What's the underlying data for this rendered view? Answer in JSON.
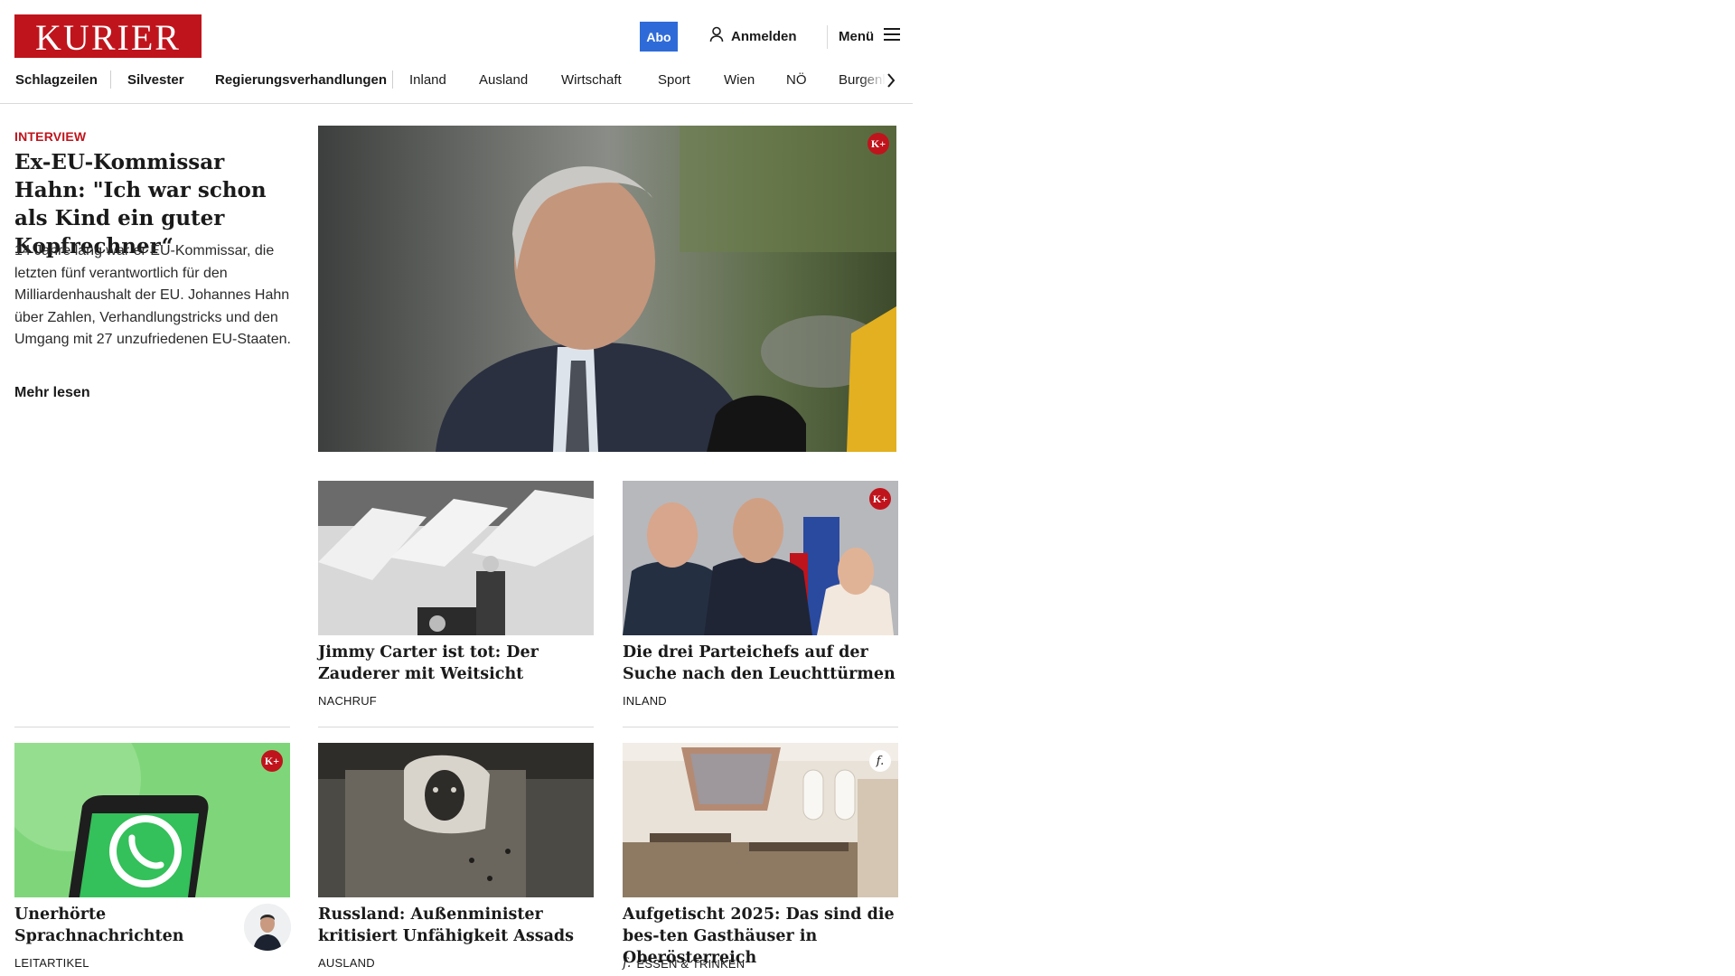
{
  "brand": {
    "name": "KURIER",
    "color": "#c0141c"
  },
  "header": {
    "abo_label": "Abo",
    "login_label": "Anmelden",
    "menu_label": "Menü"
  },
  "nav": {
    "items": [
      {
        "label": "Schlagzeilen"
      },
      {
        "label": "Silvester"
      },
      {
        "label": "Regierungsverhandlungen"
      },
      {
        "label": "Inland"
      },
      {
        "label": "Ausland"
      },
      {
        "label": "Wirtschaft"
      },
      {
        "label": "Sport"
      },
      {
        "label": "Wien"
      },
      {
        "label": "NÖ"
      },
      {
        "label": "Burgenl"
      }
    ]
  },
  "lead": {
    "kicker": "INTERVIEW",
    "title": "Ex-EU-Kommissar Hahn: \"Ich war schon als Kind ein guter Kopfrechner“",
    "teaser": "14 Jahre lang war er EU-Kommissar, die letzten fünf verantwortlich für den Milliardenhaushalt der EU. Johannes Hahn über Zahlen, Verhandlungstricks und den Umgang mit 27 unzufriedenen EU-Staaten.",
    "more": "Mehr lesen",
    "badge": "K+"
  },
  "cards": [
    {
      "title": "Jimmy Carter ist tot: Der Zauderer mit Weitsicht",
      "kicker": "NACHRUF"
    },
    {
      "title": "Die drei Parteichefs auf der Suche nach den Leuchttürmen",
      "kicker": "INLAND",
      "badge": "K+"
    },
    {
      "title": "Unerhörte Sprachnachrichten",
      "kicker": "LEITARTIKEL",
      "badge": "K+"
    },
    {
      "title": "Russland: Außenminister kritisiert Unfähigkeit Assads",
      "kicker": "AUSLAND"
    },
    {
      "title": "Aufgetischt 2025: Das sind die bes-ten Gasthäuser in Oberösterreich",
      "kicker": "ESSEN & TRINKEN",
      "badge": "f."
    }
  ],
  "colors": {
    "abo": "#2f6bd8",
    "kicker_red": "#c0141c"
  }
}
